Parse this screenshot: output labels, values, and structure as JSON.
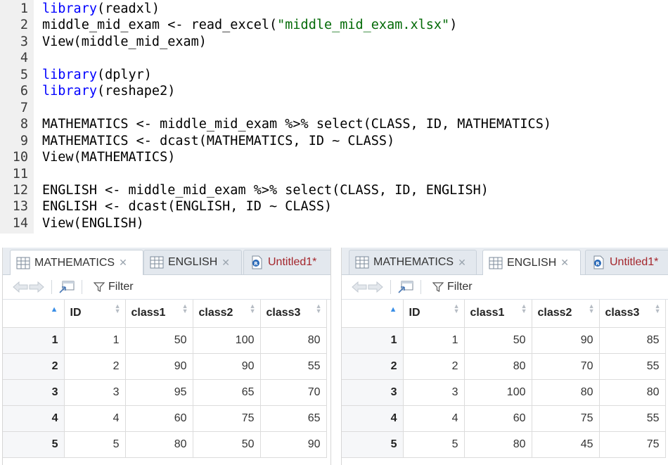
{
  "editor": {
    "lines": [
      {
        "num": "1",
        "parts": [
          [
            "kw",
            "library"
          ],
          [
            "",
            "(readxl)"
          ]
        ]
      },
      {
        "num": "2",
        "parts": [
          [
            "",
            "middle_mid_exam <- read_excel("
          ],
          [
            "str",
            "\"middle_mid_exam.xlsx\""
          ],
          [
            "",
            ")"
          ]
        ]
      },
      {
        "num": "3",
        "parts": [
          [
            "",
            "View(middle_mid_exam)"
          ]
        ]
      },
      {
        "num": "4",
        "parts": []
      },
      {
        "num": "5",
        "parts": [
          [
            "kw",
            "library"
          ],
          [
            "",
            "(dplyr)"
          ]
        ]
      },
      {
        "num": "6",
        "parts": [
          [
            "kw",
            "library"
          ],
          [
            "",
            "(reshape2)"
          ]
        ]
      },
      {
        "num": "7",
        "parts": []
      },
      {
        "num": "8",
        "parts": [
          [
            "",
            "MATHEMATICS <- middle_mid_exam %>% select(CLASS, ID, MATHEMATICS)"
          ]
        ]
      },
      {
        "num": "9",
        "parts": [
          [
            "",
            "MATHEMATICS <- dcast(MATHEMATICS, ID ~ CLASS)"
          ]
        ]
      },
      {
        "num": "10",
        "parts": [
          [
            "",
            "View(MATHEMATICS)"
          ]
        ]
      },
      {
        "num": "11",
        "parts": []
      },
      {
        "num": "12",
        "parts": [
          [
            "",
            "ENGLISH <- middle_mid_exam %>% select(CLASS, ID, ENGLISH)"
          ]
        ]
      },
      {
        "num": "13",
        "parts": [
          [
            "",
            "ENGLISH <- dcast(ENGLISH, ID ~ CLASS)"
          ]
        ]
      },
      {
        "num": "14",
        "parts": [
          [
            "",
            "View(ENGLISH)"
          ]
        ]
      }
    ]
  },
  "left_viewer": {
    "tabs": [
      {
        "label": "MATHEMATICS",
        "active": true
      },
      {
        "label": "ENGLISH",
        "active": false
      },
      {
        "label": "Untitled1*",
        "active": false
      }
    ],
    "filter_label": "Filter",
    "columns": [
      "",
      "ID",
      "class1",
      "class2",
      "class3"
    ],
    "rows": [
      [
        "1",
        "1",
        "50",
        "100",
        "80"
      ],
      [
        "2",
        "2",
        "90",
        "90",
        "55"
      ],
      [
        "3",
        "3",
        "95",
        "65",
        "70"
      ],
      [
        "4",
        "4",
        "60",
        "75",
        "65"
      ],
      [
        "5",
        "5",
        "80",
        "50",
        "90"
      ]
    ]
  },
  "right_viewer": {
    "tabs": [
      {
        "label": "MATHEMATICS",
        "active": false
      },
      {
        "label": "ENGLISH",
        "active": true
      },
      {
        "label": "Untitled1*",
        "active": false
      }
    ],
    "filter_label": "Filter",
    "columns": [
      "",
      "ID",
      "class1",
      "class2",
      "class3"
    ],
    "rows": [
      [
        "1",
        "1",
        "50",
        "90",
        "85"
      ],
      [
        "2",
        "2",
        "80",
        "70",
        "55"
      ],
      [
        "3",
        "3",
        "100",
        "80",
        "80"
      ],
      [
        "4",
        "4",
        "60",
        "75",
        "55"
      ],
      [
        "5",
        "5",
        "80",
        "45",
        "75"
      ]
    ]
  }
}
